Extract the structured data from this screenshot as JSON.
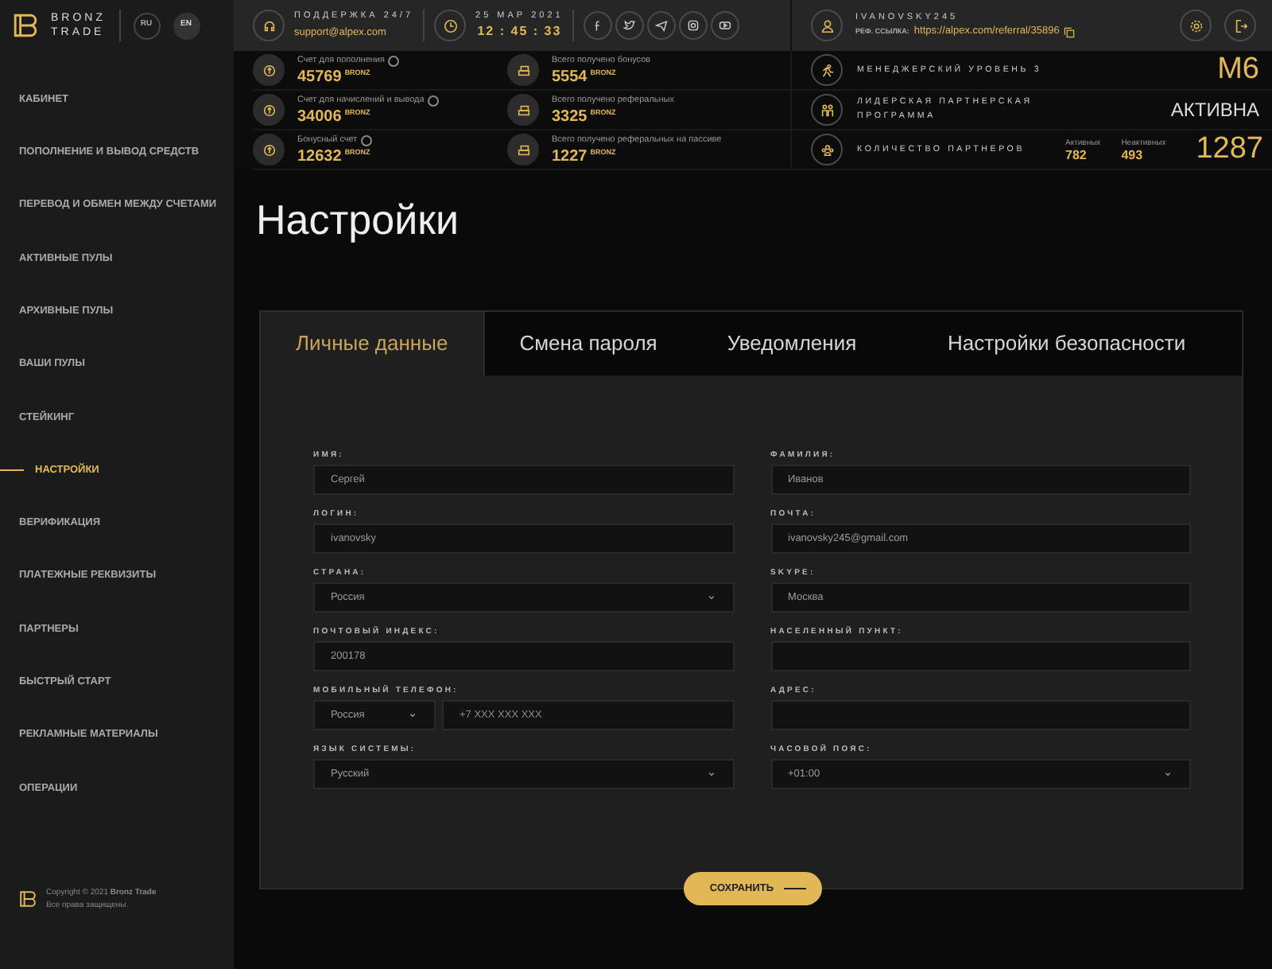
{
  "brand": {
    "line_1": "BRONZ",
    "line_2": "TRADE"
  },
  "languages": [
    {
      "label": "RU",
      "selected": false
    },
    {
      "label": "EN",
      "selected": true
    }
  ],
  "support": {
    "label": "ПОДДЕРЖКА 24/7",
    "email": "support@alpex.com"
  },
  "datetime": {
    "date": "25 МАР 2021",
    "time": "12 : 45 : 33"
  },
  "user": {
    "username": "IVANOVSKY245",
    "ref_label": "РЕФ. ССЫЛКА:",
    "ref_link": "https://alpex.com/referral/35896"
  },
  "balances": [
    {
      "label": "Счет для пополнения",
      "value": "45769",
      "unit": "BRONZ",
      "help": true
    },
    {
      "label": "Всего получено бонусов",
      "value": "5554",
      "unit": "BRONZ",
      "help": false
    },
    {
      "label": "Счет для начислений и вывода",
      "value": "34006",
      "unit": "BRONZ",
      "help": true
    },
    {
      "label": "Всего получено реферальных",
      "value": "3325",
      "unit": "BRONZ",
      "help": false
    },
    {
      "label": "Бонусный счет",
      "value": "12632",
      "unit": "BRONZ",
      "help": true
    },
    {
      "label": "Всего получено реферальных на пассиве",
      "value": "1227",
      "unit": "BRONZ",
      "help": false
    }
  ],
  "status": [
    {
      "kind": "level",
      "label": "МЕНЕДЖЕРСКИЙ УРОВЕНЬ 3",
      "value": "M6"
    },
    {
      "kind": "program",
      "label": "ЛИДЕРСКАЯ ПАРТНЕРСКАЯ ПРОГРАММА",
      "value": "АКТИВНА"
    },
    {
      "kind": "partners",
      "label": "КОЛИЧЕСТВО ПАРТНЕРОВ",
      "active_label": "Активных",
      "active": "782",
      "inactive_label": "Неактивных",
      "inactive": "493",
      "value": "1287"
    }
  ],
  "sidebar": {
    "items": [
      {
        "label": "КАБИНЕТ",
        "selected": false
      },
      {
        "label": "ПОПОЛНЕНИЕ И ВЫВОД СРЕДСТВ",
        "selected": false
      },
      {
        "label": "ПЕРЕВОД И ОБМЕН МЕЖДУ СЧЕТАМИ",
        "selected": false
      },
      {
        "label": "АКТИВНЫЕ ПУЛЫ",
        "selected": false
      },
      {
        "label": "АРХИВНЫЕ ПУЛЫ",
        "selected": false
      },
      {
        "label": "ВАШИ ПУЛЫ",
        "selected": false
      },
      {
        "label": "СТЕЙКИНГ",
        "selected": false
      },
      {
        "label": "НАСТРОЙКИ",
        "selected": true
      },
      {
        "label": "ВЕРИФИКАЦИЯ",
        "selected": false
      },
      {
        "label": "ПЛАТЕЖНЫЕ РЕКВИЗИТЫ",
        "selected": false
      },
      {
        "label": "ПАРТНЕРЫ",
        "selected": false
      },
      {
        "label": "БЫСТРЫЙ СТАРТ",
        "selected": false
      },
      {
        "label": "РЕКЛАМНЫЕ МАТЕРИАЛЫ",
        "selected": false
      },
      {
        "label": "ОПЕРАЦИИ",
        "selected": false
      }
    ],
    "footer": {
      "copyright": "Copyright © 2021 **Bronz Trade**",
      "rights": "Все права защищены."
    }
  },
  "page_title": "Настройки",
  "tabs": [
    {
      "label": "Личные данные",
      "selected": true
    },
    {
      "label": "Смена пароля",
      "selected": false
    },
    {
      "label": "Уведомления",
      "selected": false
    },
    {
      "label": "Настройки безопасности",
      "selected": false
    }
  ],
  "form": {
    "left": [
      {
        "kind": "text",
        "label": "ИМЯ:",
        "value": "Сергей"
      },
      {
        "kind": "text",
        "label": "ЛОГИН:",
        "value": "ivanovsky"
      },
      {
        "kind": "select",
        "label": "СТРАНА:",
        "value": "Россия"
      },
      {
        "kind": "text",
        "label": "ПОЧТОВЫЙ ИНДЕКС:",
        "value": "200178"
      },
      {
        "kind": "phone",
        "label": "МОБИЛЬНЫЙ ТЕЛЕФОН:",
        "value": "Россия",
        "placeholder": "+7 XXX XXX XXX"
      },
      {
        "kind": "select",
        "label": "ЯЗЫК СИСТЕМЫ:",
        "value": "Русский"
      }
    ],
    "right": [
      {
        "kind": "text",
        "label": "ФАМИЛИЯ:",
        "value": "Иванов"
      },
      {
        "kind": "text",
        "label": "ПОЧТА:",
        "value": "ivanovsky245@gmail.com"
      },
      {
        "kind": "text",
        "label": "SKYPE:",
        "value": "Москва"
      },
      {
        "kind": "text",
        "label": "НАСЕЛЕННЫЙ ПУНКТ:"
      },
      {
        "kind": "text",
        "label": "АДРЕС:"
      },
      {
        "kind": "select",
        "label": "ЧАСОВОЙ ПОЯС:",
        "value": "+01:00"
      }
    ]
  },
  "save_button": "СОХРАНИТЬ"
}
